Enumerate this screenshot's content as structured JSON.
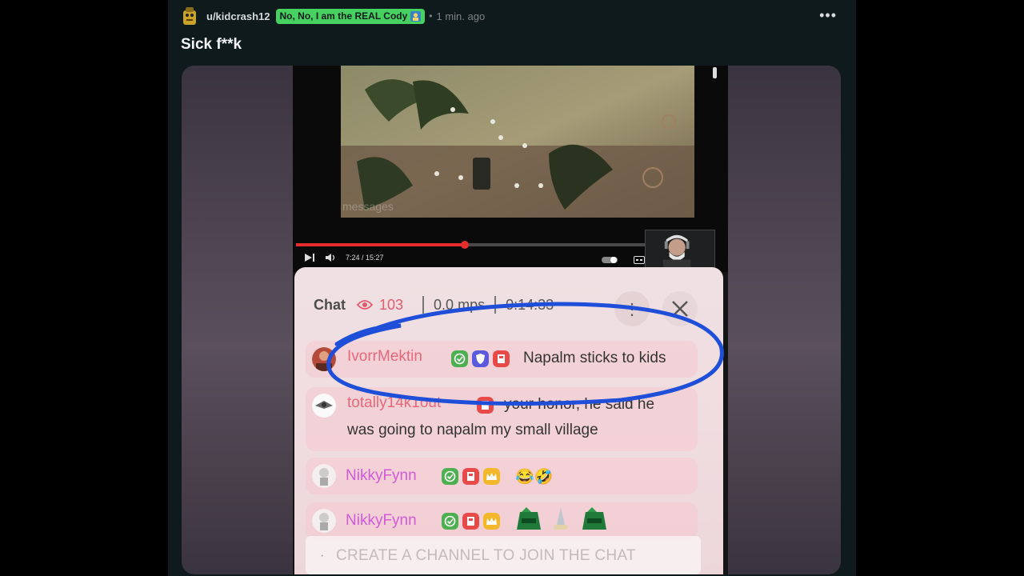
{
  "post": {
    "username": "u/kidcrash12",
    "flair": "No, No, I am the REAL Cody",
    "separator": "•",
    "timestamp": "1 min. ago",
    "more_label": "•••",
    "title": "Sick f**k"
  },
  "video": {
    "overlay_text": "messages",
    "time": "7:24 / 15:27",
    "progress_fraction": 0.483
  },
  "chat": {
    "title": "Chat",
    "viewer_count": "103",
    "mps": "0.0 mps",
    "uptime": "0:14:33",
    "menu_label": "⋮",
    "messages": [
      {
        "user": "IvorrMektin",
        "user_color": "#e8687a",
        "text": "Napalm sticks to kids"
      },
      {
        "user": "totally14k1out",
        "user_color": "#e8687a",
        "text": "your honor, he said he",
        "text_line2": "was going to napalm my small village"
      },
      {
        "user": "NikkyFynn",
        "user_color": "#d45ad8",
        "text": "😂🤣"
      },
      {
        "user": "NikkyFynn",
        "user_color": "#d45ad8",
        "text": ""
      }
    ],
    "input_placeholder": "CREATE A CHANNEL TO JOIN THE CHAT"
  },
  "colors": {
    "annotation": "#1f4fd8",
    "flair_bg": "#46d160",
    "accent_red": "#e52d2d"
  },
  "icons": [
    "reddit-avatar-icon",
    "flair-emoji-icon",
    "more-options-icon",
    "next-icon",
    "volume-icon",
    "eye-icon",
    "kebab-icon",
    "close-icon",
    "verified-badge-icon",
    "shield-badge-icon",
    "mod-badge-icon",
    "emote-icon"
  ]
}
